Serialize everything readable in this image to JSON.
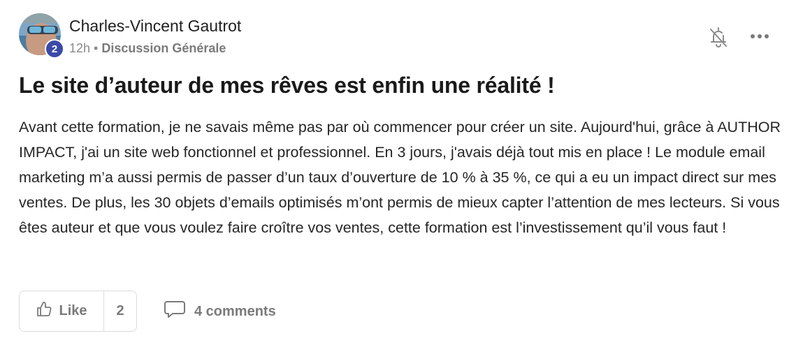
{
  "post": {
    "author": "Charles-Vincent Gautrot",
    "level_badge": "2",
    "time": "12h",
    "separator": "•",
    "category": "Discussion Générale",
    "title": "Le site d’auteur de mes rêves est enfin une réalité !",
    "body": "Avant cette formation, je ne savais même pas par où commencer pour créer un site. Aujourd'hui, grâce à AUTHOR IMPACT, j'ai un site web fonctionnel et professionnel. En 3 jours, j'avais déjà tout mis en place ! Le module email marketing m’a aussi permis de passer d’un taux d’ouverture de 10 % à 35 %, ce qui a eu un impact direct sur mes ventes. De plus, les 30 objets d’emails optimisés m’ont permis de mieux capter l’attention de mes lecteurs. Si vous êtes auteur et que vous voulez faire croître vos ventes, cette formation est l’investissement qu’il vous faut !",
    "like_label": "Like",
    "like_count": "2",
    "comments_label": "4 comments"
  },
  "icons": {
    "bell": "bell-off-icon",
    "more": "more-horizontal-icon",
    "like": "thumbs-up-icon",
    "comment": "comment-icon"
  },
  "colors": {
    "badge": "#3b4aa8",
    "muted": "#7a7a7a"
  }
}
